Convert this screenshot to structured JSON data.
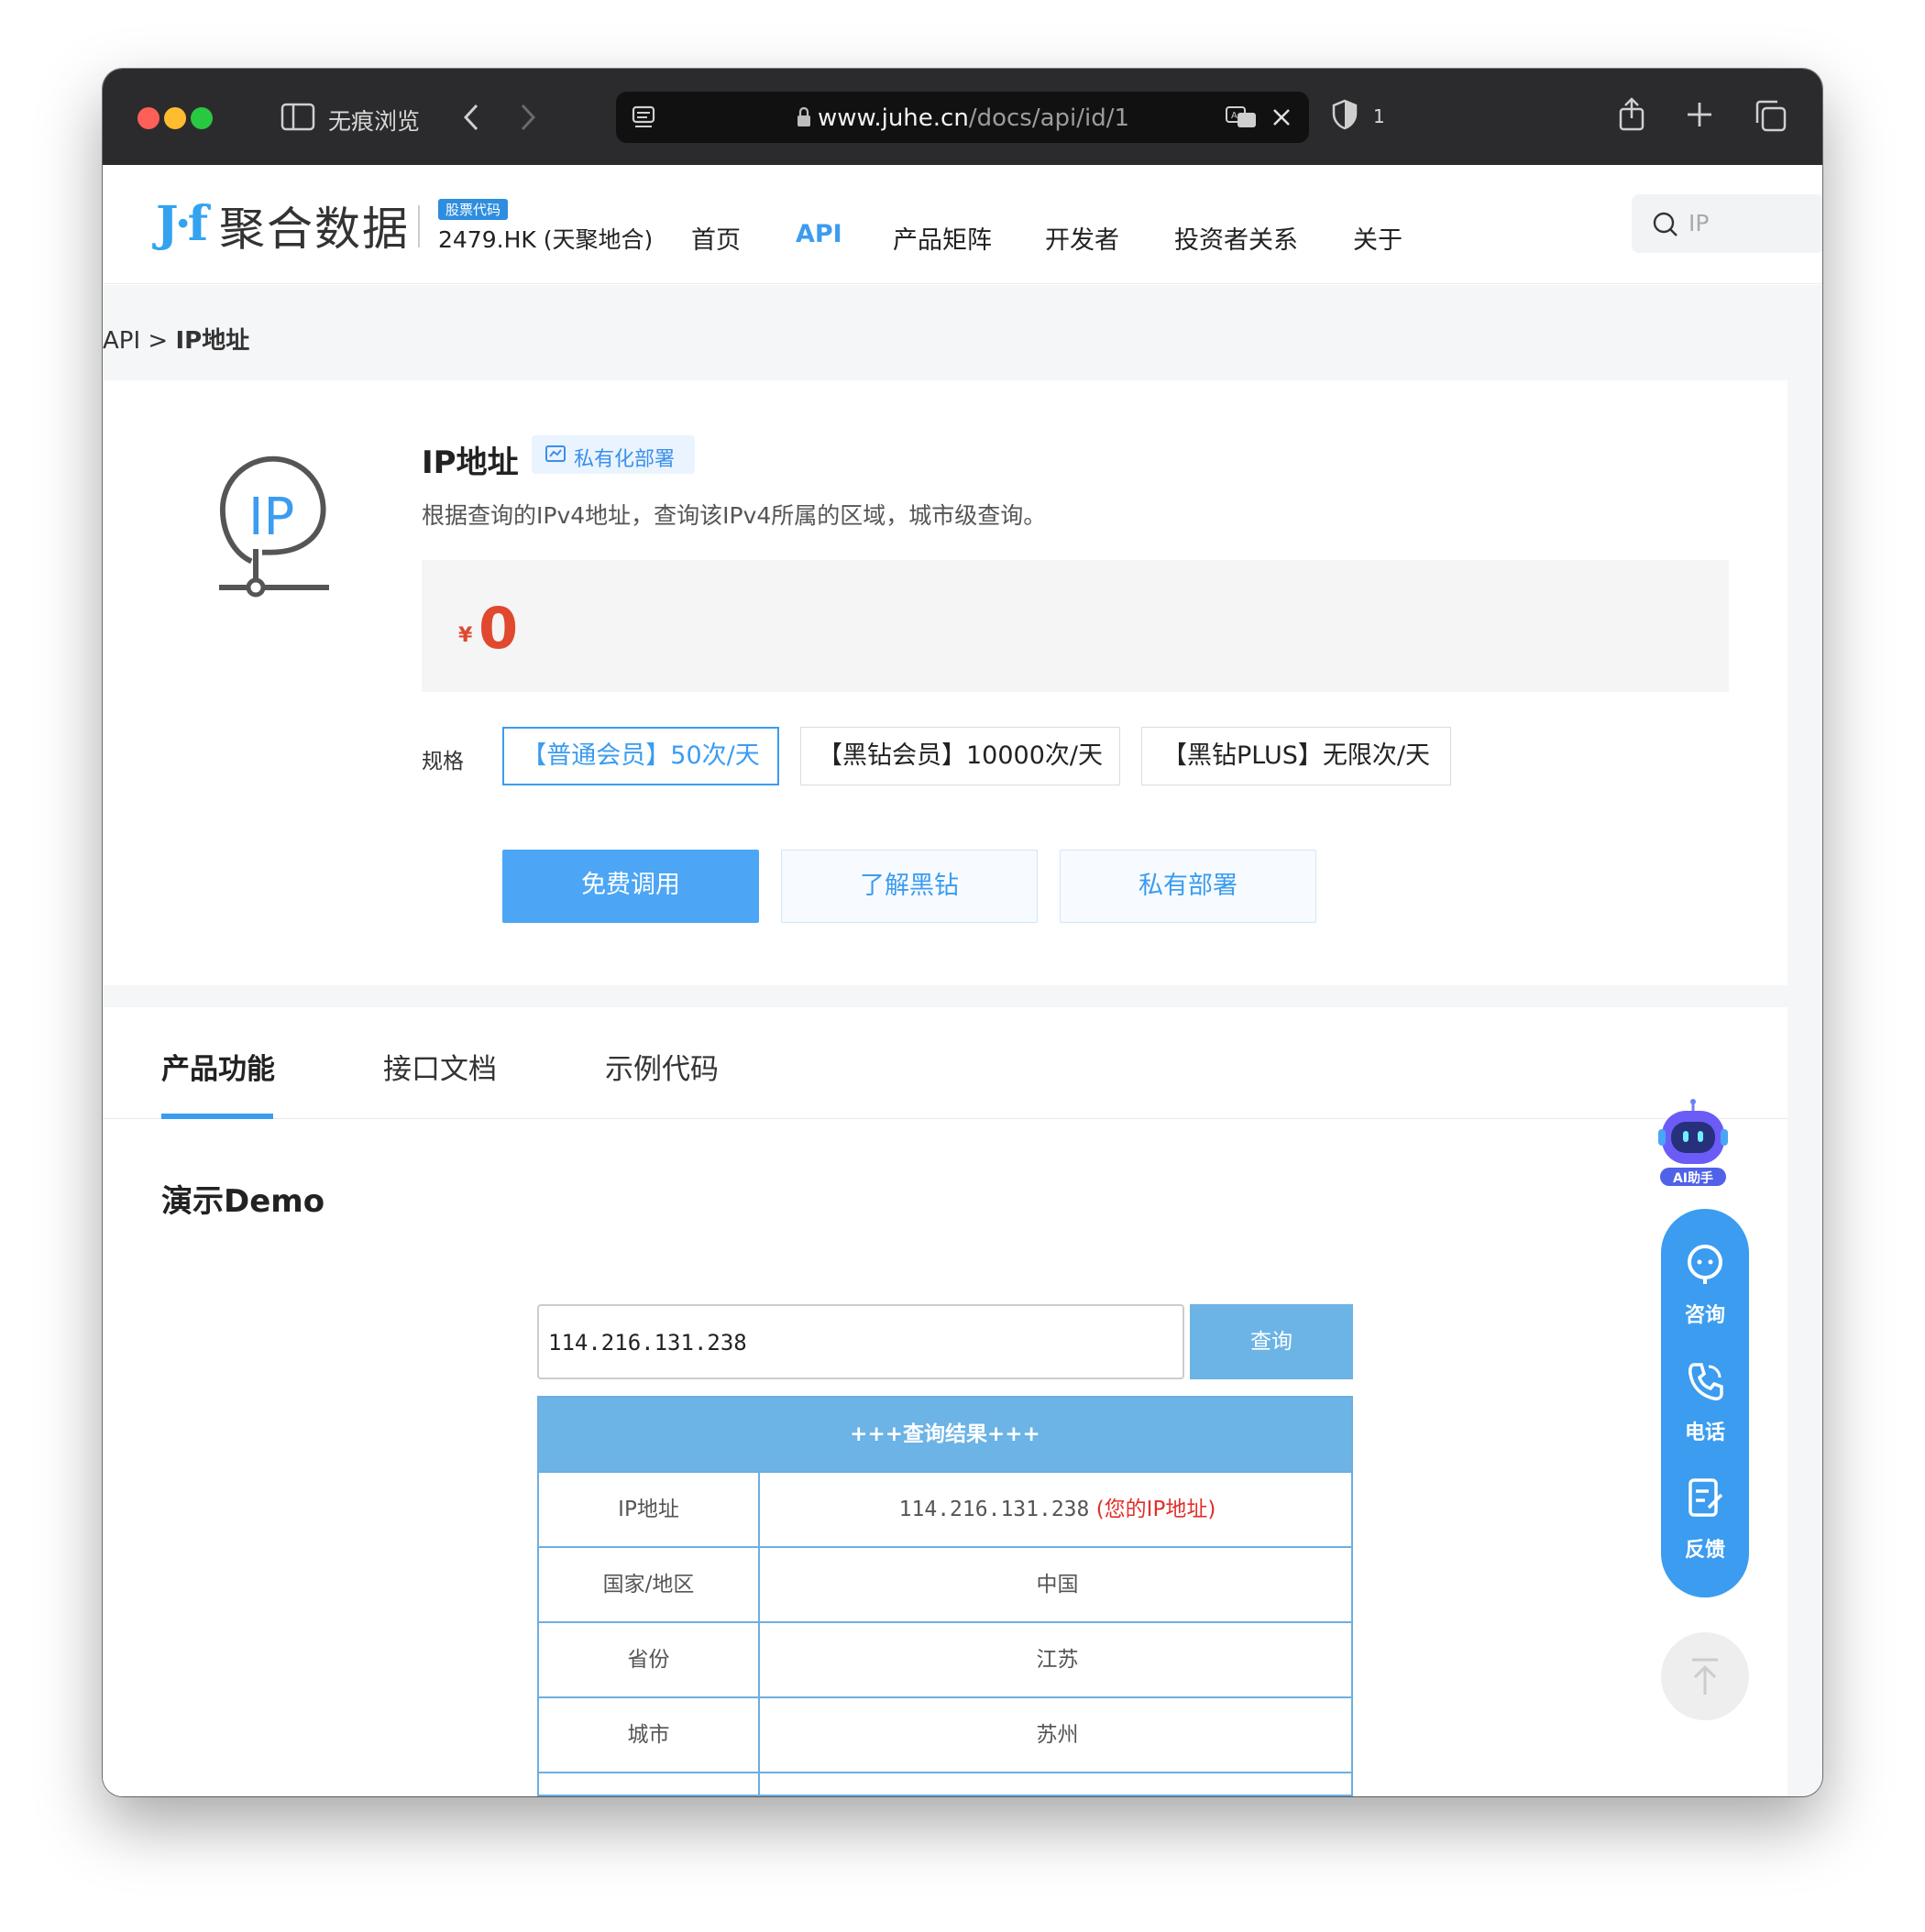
{
  "browser": {
    "private_label": "无痕浏览",
    "url_host": "www.juhe.cn",
    "url_path": "/docs/api/id/1",
    "shield_count": "1"
  },
  "site": {
    "logo_text": "聚合数据",
    "stock_badge": "股票代码",
    "stock_code": "2479.HK (天聚地合)",
    "nav": [
      "首页",
      "API",
      "产品矩阵",
      "开发者",
      "投资者关系",
      "关于"
    ],
    "nav_active": "API",
    "search_placeholder": "IP"
  },
  "breadcrumb": {
    "root": "API",
    "sep": ">",
    "current": "IP地址"
  },
  "product": {
    "title": "IP地址",
    "private_tag": "私有化部署",
    "description": "根据查询的IPv4地址，查询该IPv4所属的区域，城市级查询。",
    "currency": "¥",
    "price": "0",
    "spec_label": "规格",
    "specs": [
      "【普通会员】50次/天",
      "【黑钻会员】10000次/天",
      "【黑钻PLUS】无限次/天"
    ],
    "buttons": {
      "free": "免费调用",
      "learn": "了解黑钻",
      "private": "私有部署"
    }
  },
  "tabs": [
    "产品功能",
    "接口文档",
    "示例代码"
  ],
  "demo": {
    "title": "演示Demo",
    "input_value": "114.216.131.238",
    "query_button": "查询",
    "result_header": "+++查询结果+++",
    "rows": [
      {
        "key": "IP地址",
        "value": "114.216.131.238",
        "note": "(您的IP地址)"
      },
      {
        "key": "国家/地区",
        "value": "中国"
      },
      {
        "key": "省份",
        "value": "江苏"
      },
      {
        "key": "城市",
        "value": "苏州"
      }
    ]
  },
  "float": {
    "ai_label": "AI助手",
    "consult": "咨询",
    "phone": "电话",
    "feedback": "反馈"
  },
  "colors": {
    "accent": "#3b9cf0",
    "price": "#e0482f",
    "table_header": "#6cb3e6"
  }
}
